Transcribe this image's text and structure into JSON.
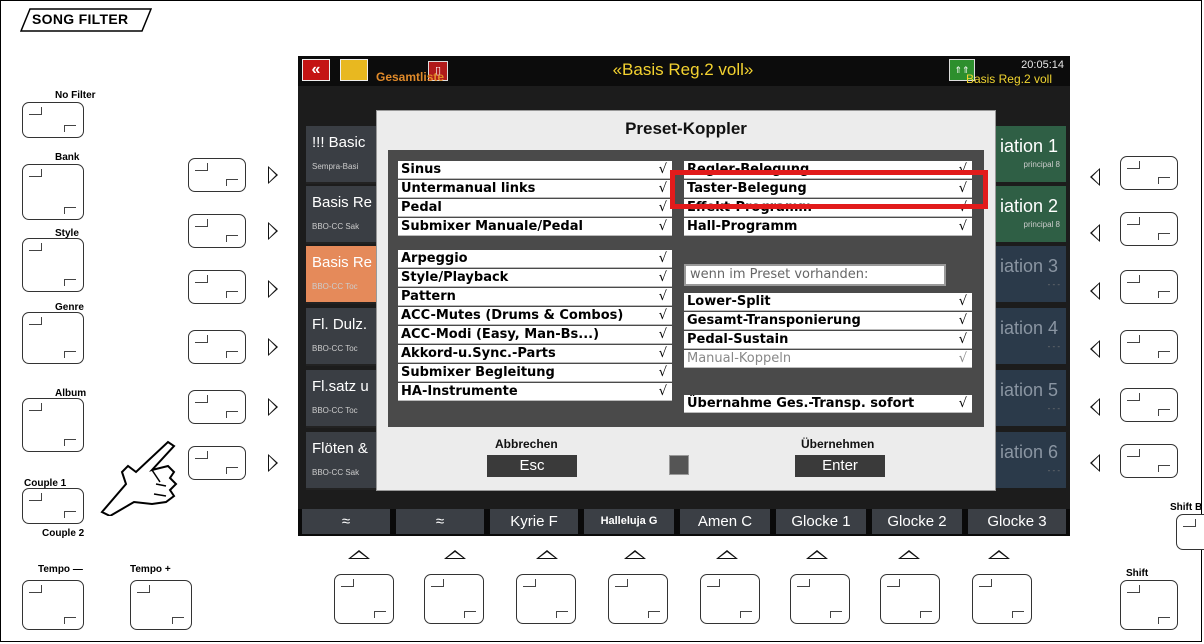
{
  "header": {
    "song_filter": "SONG FILTER"
  },
  "left_panel": {
    "no_filter": "No Filter",
    "bank": "Bank",
    "style": "Style",
    "genre": "Genre",
    "album": "Album",
    "couple1": "Couple 1",
    "couple2": "Couple 2",
    "tempo_minus": "Tempo —",
    "tempo_plus": "Tempo +"
  },
  "right_panel": {
    "shift_top": "Shift B",
    "shift": "Shift"
  },
  "screen": {
    "title": "«Basis Reg.2 voll»",
    "clock": "20:05:14",
    "gesamtliste": "Gesamtliste",
    "basis_right": "Basis Reg.2 voll",
    "left_tiles": [
      {
        "name": "!!! Basic",
        "sub": "Sempra-Basi"
      },
      {
        "name": "Basis Re",
        "sub": "BBO-CC Sak"
      },
      {
        "name": "Basis Re",
        "sub": "BBO-CC Toc"
      },
      {
        "name": "Fl. Dulz.",
        "sub": "BBO-CC Toc"
      },
      {
        "name": "Fl.satz u",
        "sub": "BBO-CC Toc"
      },
      {
        "name": "Flöten &",
        "sub": "BBO-CC Sak"
      }
    ],
    "right_tiles": [
      {
        "name": "iation 1",
        "sub": "principal   8"
      },
      {
        "name": "iation 2",
        "sub": "principal   8"
      },
      {
        "name": "iation 3",
        "sub": "- - -"
      },
      {
        "name": "iation 4",
        "sub": "- - -"
      },
      {
        "name": "iation 5",
        "sub": "- - -"
      },
      {
        "name": "iation 6",
        "sub": "- - -"
      }
    ],
    "softkeys": [
      "≈",
      "≈",
      "Kyrie F",
      "Halleluja G",
      "Amen  C",
      "Glocke 1",
      "Glocke 2",
      "Glocke 3"
    ]
  },
  "dialog": {
    "title": "Preset-Koppler",
    "left_group1": [
      {
        "label": "Sinus",
        "check": "√"
      },
      {
        "label": "Untermanual links",
        "check": "√"
      },
      {
        "label": "Pedal",
        "check": "√"
      },
      {
        "label": "Submixer Manuale/Pedal",
        "check": "√"
      }
    ],
    "left_group2": [
      {
        "label": "Arpeggio",
        "check": "√"
      },
      {
        "label": "Style/Playback",
        "check": "√"
      },
      {
        "label": "Pattern",
        "check": "√"
      },
      {
        "label": "ACC-Mutes (Drums & Combos)",
        "check": "√"
      },
      {
        "label": "ACC-Modi (Easy, Man-Bs...)",
        "check": "√"
      },
      {
        "label": "Akkord-u.Sync.-Parts",
        "check": "√"
      },
      {
        "label": "Submixer Begleitung",
        "check": "√"
      },
      {
        "label": "HA-Instrumente",
        "check": "√"
      }
    ],
    "right_group1": [
      {
        "label": "Regler-Belegung",
        "check": "√"
      },
      {
        "label": "Taster-Belegung",
        "check": "√"
      },
      {
        "label": "Effekt-Programm",
        "check": "√"
      },
      {
        "label": "Hall-Programm",
        "check": "√"
      }
    ],
    "wenn_label": "wenn im Preset vorhanden:",
    "right_group2": [
      {
        "label": "Lower-Split",
        "check": "√"
      },
      {
        "label": "Gesamt-Transponierung",
        "check": "√"
      },
      {
        "label": "Pedal-Sustain",
        "check": "√"
      },
      {
        "label": "Manual-Koppeln",
        "check": "√"
      }
    ],
    "uebernahme": {
      "label": "Übernahme Ges.-Transp. sofort",
      "check": "√"
    },
    "cancel_label": "Abbrechen",
    "cancel_key": "Esc",
    "ok_label": "Übernehmen",
    "ok_key": "Enter"
  },
  "colors": {
    "title": "#f3d230",
    "highlight": "#e21b1b",
    "selected_tile": "#e58a5a",
    "active_variation": "#2f5f45"
  }
}
